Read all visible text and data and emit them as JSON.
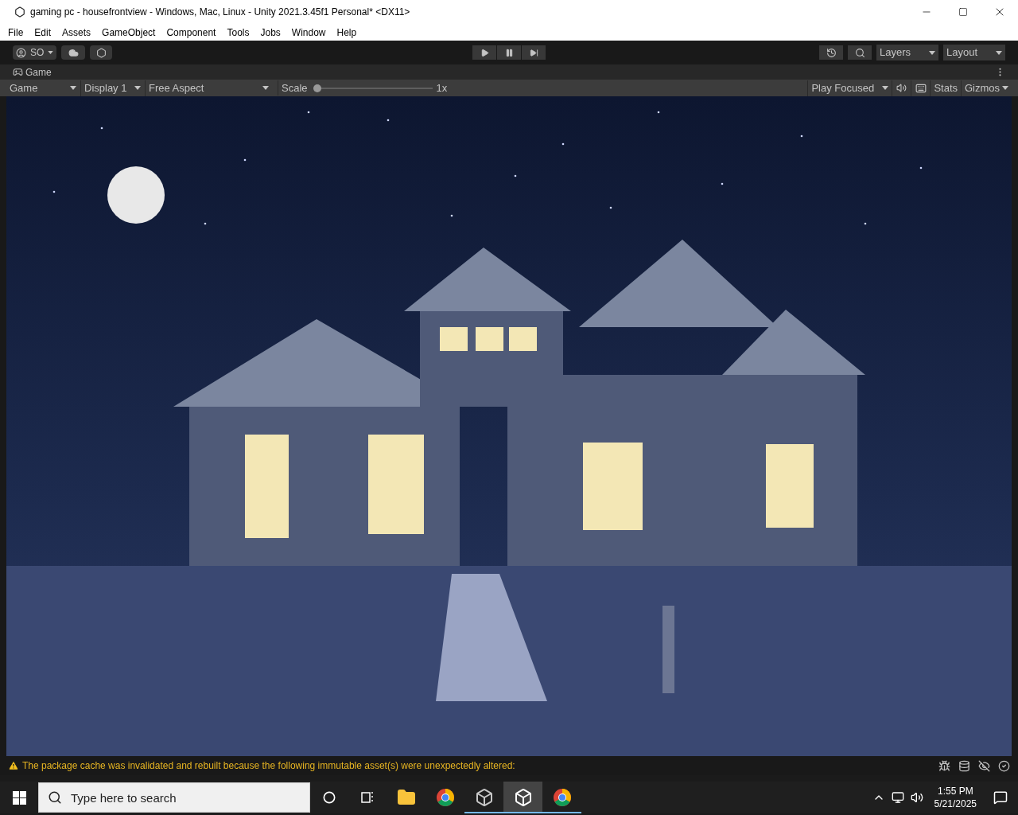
{
  "window": {
    "title": "gaming pc - housefrontview - Windows, Mac, Linux - Unity 2021.3.45f1 Personal* <DX11>"
  },
  "menu": [
    "File",
    "Edit",
    "Assets",
    "GameObject",
    "Component",
    "Tools",
    "Jobs",
    "Window",
    "Help"
  ],
  "toolbar": {
    "account": "SO",
    "layers": "Layers",
    "layout": "Layout"
  },
  "game_tab": {
    "label": "Game"
  },
  "game_toolbar": {
    "view": "Game",
    "display": "Display 1",
    "aspect": "Free Aspect",
    "scale_label": "Scale",
    "scale": {
      "level": 0
    },
    "scale_reading": "1x",
    "play_mode": "Play Focused",
    "stats": "Stats",
    "gizmos": "Gizmos"
  },
  "status_bar": {
    "message": "The package cache was invalidated and rebuilt because the following immutable asset(s) were unexpectedly altered:"
  },
  "taskbar": {
    "search": {
      "placeholder": "Type here to search"
    },
    "apps": [
      {
        "kind": "explorer",
        "selected": false,
        "running": false
      },
      {
        "kind": "chrome",
        "selected": false,
        "running": false
      },
      {
        "kind": "unityhub",
        "selected": false,
        "running": true
      },
      {
        "kind": "unity",
        "selected": true,
        "running": true
      },
      {
        "kind": "chrome",
        "selected": false,
        "running": true
      }
    ],
    "time": "1:55 PM",
    "date": "5/21/2025"
  }
}
